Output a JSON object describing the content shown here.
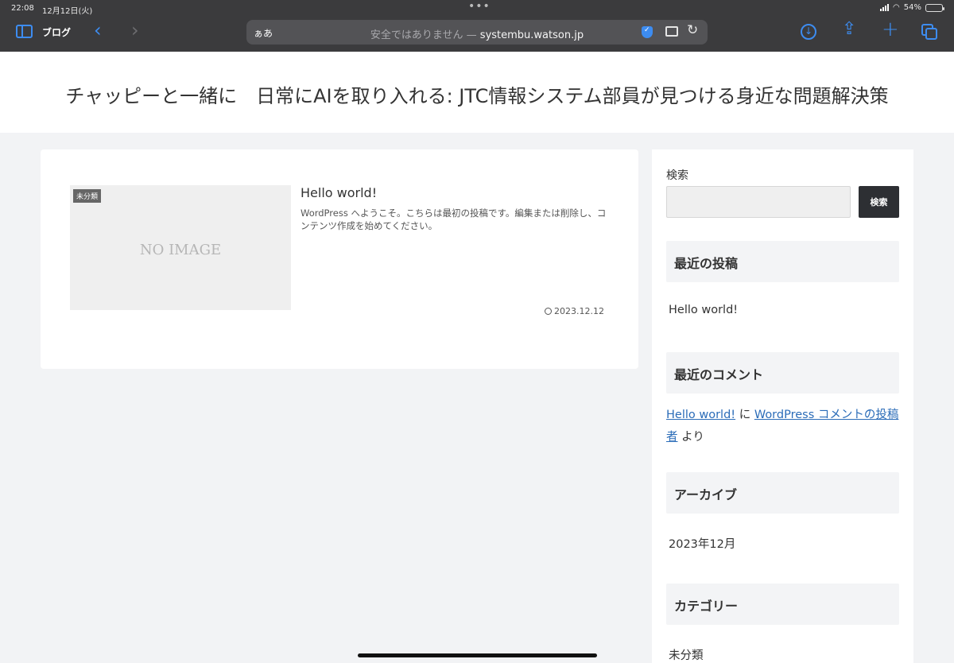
{
  "status": {
    "time": "22:08",
    "date": "12月12日(火)",
    "battery": "54%",
    "battery_level": 0.54
  },
  "toolbar": {
    "tab_group": "ブログ",
    "address_aa": "ぁあ",
    "address_security": "安全ではありません —",
    "address_domain": "systembu.watson.jp"
  },
  "site": {
    "title": "チャッピーと一緒に　日常にAIを取り入れる: JTC情報システム部員が見つける身近な問題解決策"
  },
  "post": {
    "category": "未分類",
    "thumbnail_text": "NO IMAGE",
    "title": "Hello world!",
    "excerpt": "WordPress へようこそ。こちらは最初の投稿です。編集または削除し、コンテンツ作成を始めてください。",
    "date": "2023.12.12"
  },
  "sidebar": {
    "search_label": "検索",
    "search_value": "",
    "search_button": "検索",
    "recent_posts_heading": "最近の投稿",
    "recent_post_item": "Hello world!",
    "recent_comments_heading": "最近のコメント",
    "comment_post_link": "Hello world!",
    "comment_on": "に",
    "comment_author_link": "WordPress コメントの投稿者",
    "comment_by": "より",
    "archive_heading": "アーカイブ",
    "archive_item": "2023年12月",
    "category_heading": "カテゴリー",
    "category_item": "未分類"
  },
  "colors": {
    "browser_chrome": "#3b3b3d",
    "accent_blue": "#3d8cf0",
    "page_background": "#f2f3f5",
    "link": "#2b6cb8",
    "search_button": "#2d2f33"
  }
}
